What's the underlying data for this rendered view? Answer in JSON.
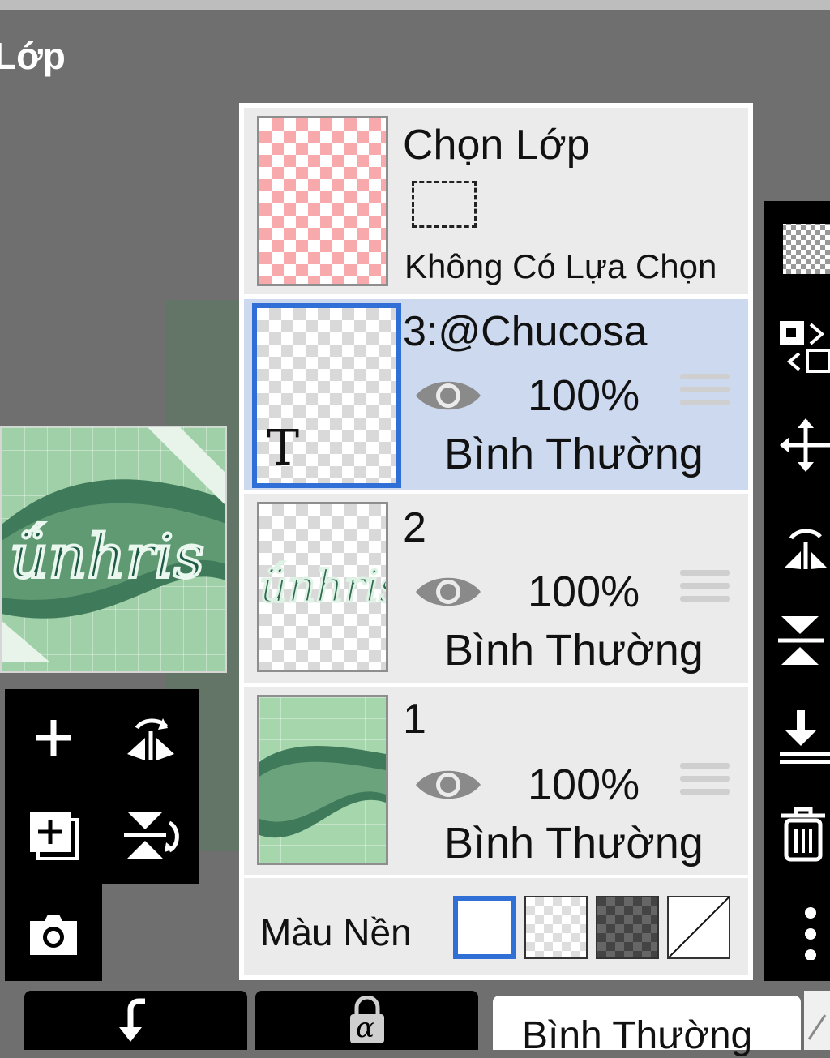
{
  "header": {
    "title": "Lớp"
  },
  "selection_layer": {
    "title": "Chọn Lớp",
    "status": "Không Có Lựa Chọn"
  },
  "layers": [
    {
      "name": "3:@Chucosa",
      "opacity": "100%",
      "blend_mode": "Bình Thường",
      "visible": true,
      "selected": true,
      "type_badge": "T"
    },
    {
      "name": "2",
      "opacity": "100%",
      "blend_mode": "Bình Thường",
      "visible": true,
      "selected": false
    },
    {
      "name": "1",
      "opacity": "100%",
      "blend_mode": "Bình Thường",
      "visible": true,
      "selected": false
    }
  ],
  "background": {
    "label": "Màu Nền",
    "options": [
      "white",
      "transparent-light",
      "transparent-dark",
      "none"
    ],
    "selected": "white"
  },
  "bottom_bar": {
    "blend_mode": "Bình Thường",
    "lock_label": "α"
  },
  "colors": {
    "selection_blue": "#2f6fd6",
    "selected_row": "#ccd9ee",
    "row_bg": "#ebebeb",
    "toolbar_bg": "#000000"
  },
  "icons": {
    "left_tools": [
      "add-layer-icon",
      "flip-horizontal-icon",
      "duplicate-layer-icon",
      "flip-vertical-icon",
      "camera-icon"
    ],
    "right_tools": [
      "transparency-icon",
      "swap-layer-icon",
      "move-icon",
      "flip-horizontal-icon",
      "flip-vertical-icon",
      "merge-down-icon",
      "trash-icon",
      "more-icon"
    ]
  }
}
